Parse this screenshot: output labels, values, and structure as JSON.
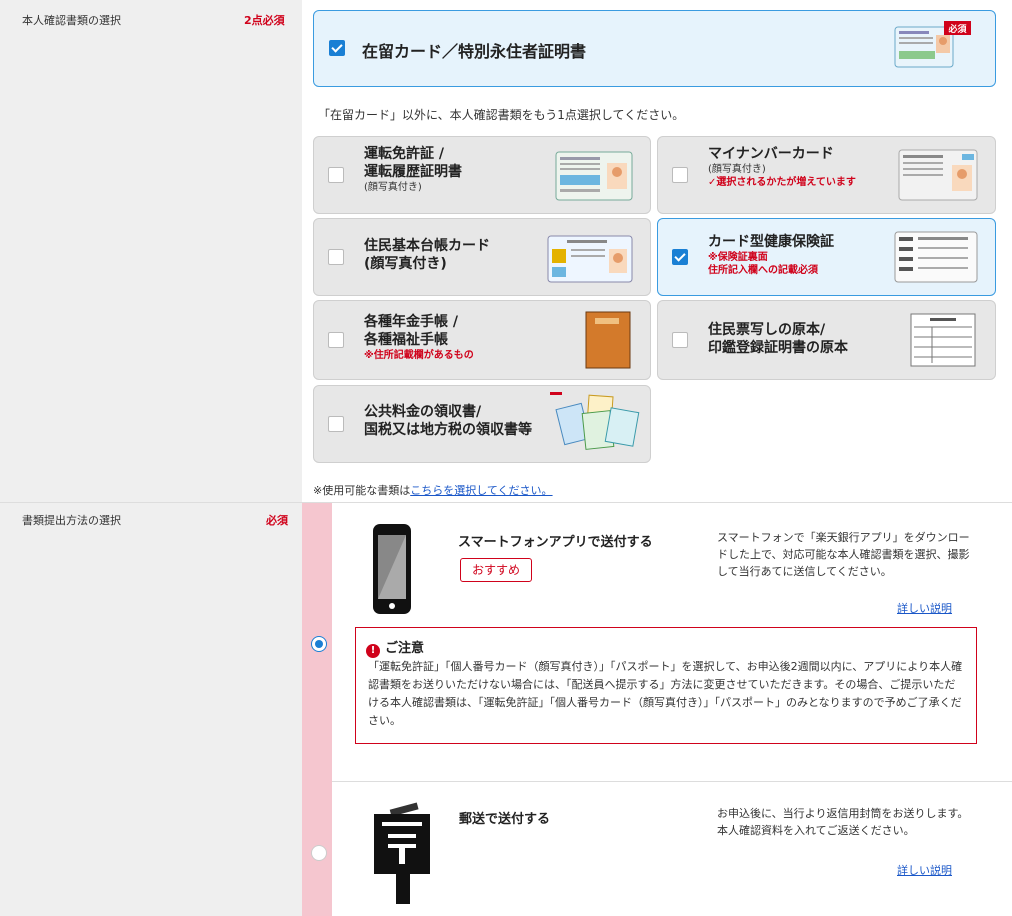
{
  "section1": {
    "label": "本人確認書類の選択",
    "required": "2点必須"
  },
  "residence_card": {
    "title": "在留カード／特別永住者証明書",
    "checked": true,
    "badge": "必須"
  },
  "instruction": "「在留カード」以外に、本人確認書類をもう1点選択してください。",
  "documents": [
    {
      "line1": "運転免許証 /",
      "line2": "運転履歴証明書",
      "sub": "(顔写真付き)",
      "note": "",
      "checked": false
    },
    {
      "line1": "マイナンバーカード",
      "line2": "",
      "sub": "(顔写真付き)",
      "note": "✓選択されるかたが増えています",
      "checked": false
    },
    {
      "line1": "住民基本台帳カード",
      "line2": "(顔写真付き)",
      "sub": "",
      "note": "",
      "checked": false
    },
    {
      "line1": "カード型健康保険証",
      "line2": "",
      "sub": "",
      "note": "※保険証裏面",
      "note2": "住所記入欄への記載必須",
      "checked": true
    },
    {
      "line1": "各種年金手帳 /",
      "line2": "各種福祉手帳",
      "sub": "",
      "note": "※住所記載欄があるもの",
      "checked": false
    },
    {
      "line1": "住民票写しの原本/",
      "line2": "印鑑登録証明書の原本",
      "sub": "",
      "note": "",
      "checked": false
    },
    {
      "line1": "公共料金の領収書/",
      "line2": "国税又は地方税の領収書等",
      "sub": "",
      "note": "",
      "checked": false
    }
  ],
  "usable_note": {
    "prefix": "※使用可能な書類は",
    "link": "こちらを選択してください。"
  },
  "section2": {
    "label": "書類提出方法の選択",
    "required": "必須"
  },
  "methods": [
    {
      "title": "スマートフォンアプリで送付する",
      "badge": "おすすめ",
      "desc": "スマートフォンで「楽天銀行アプリ」をダウンロードした上で、対応可能な本人確認書類を選択、撮影して当行あてに送信してください。",
      "detail": "詳しい説明",
      "selected": true
    },
    {
      "title": "郵送で送付する",
      "desc": "お申込後に、当行より返信用封筒をお送りします。本人確認資料を入れてご返送ください。",
      "detail": "詳しい説明",
      "selected": false
    }
  ],
  "warning": {
    "title": "ご注意",
    "body": "「運転免許証」「個人番号カード（顔写真付き）」「パスポート」を選択して、お申込後2週間以内に、アプリにより本人確認書類をお送りいただけない場合には、「配送員へ提示する」方法に変更させていただきます。その場合、ご提示いただける本人確認書類は、「運転免許証」「個人番号カード（顔写真付き）」「パスポート」のみとなりますので予めご了承ください。"
  }
}
